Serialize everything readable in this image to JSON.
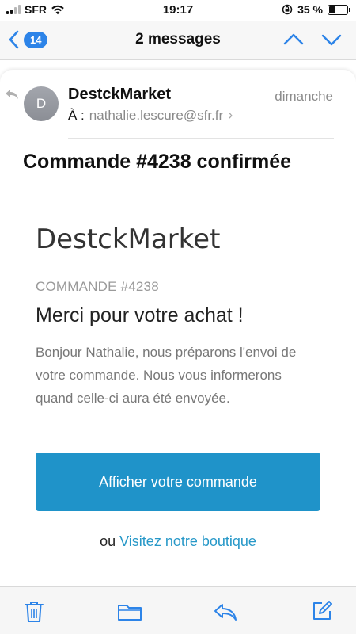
{
  "status_bar": {
    "carrier": "SFR",
    "time": "19:17",
    "battery_percent": "35 %",
    "battery_level": 0.35,
    "icons": [
      "signal-icon",
      "wifi-icon",
      "orientation-lock-icon",
      "battery-icon"
    ]
  },
  "nav": {
    "unread_count": "14",
    "title": "2 messages",
    "icons": [
      "back-chevron-icon",
      "previous-message-icon",
      "next-message-icon"
    ]
  },
  "email": {
    "avatar_initial": "D",
    "sender": "DestckMarket",
    "date": "dimanche",
    "to_label": "À :",
    "to_address": "nathalie.lescure@sfr.fr",
    "subject": "Commande #4238 confirmée"
  },
  "body": {
    "brand": "DestckMarket",
    "order_label": "COMMANDE #4238",
    "thanks": "Merci pour votre achat !",
    "message": "Bonjour Nathalie, nous préparons l'envoi de votre commande. Nous vous informerons quand celle-ci aura été envoyée.",
    "cta_label": "Afficher votre commande",
    "or_text": "ou",
    "shop_link": "Visitez notre boutique"
  },
  "toolbar": {
    "icons": [
      "trash-icon",
      "folder-icon",
      "reply-icon",
      "compose-icon"
    ]
  },
  "colors": {
    "ios_blue": "#2d84e8",
    "cta_blue": "#1f93c9",
    "link_blue": "#2798c8"
  }
}
